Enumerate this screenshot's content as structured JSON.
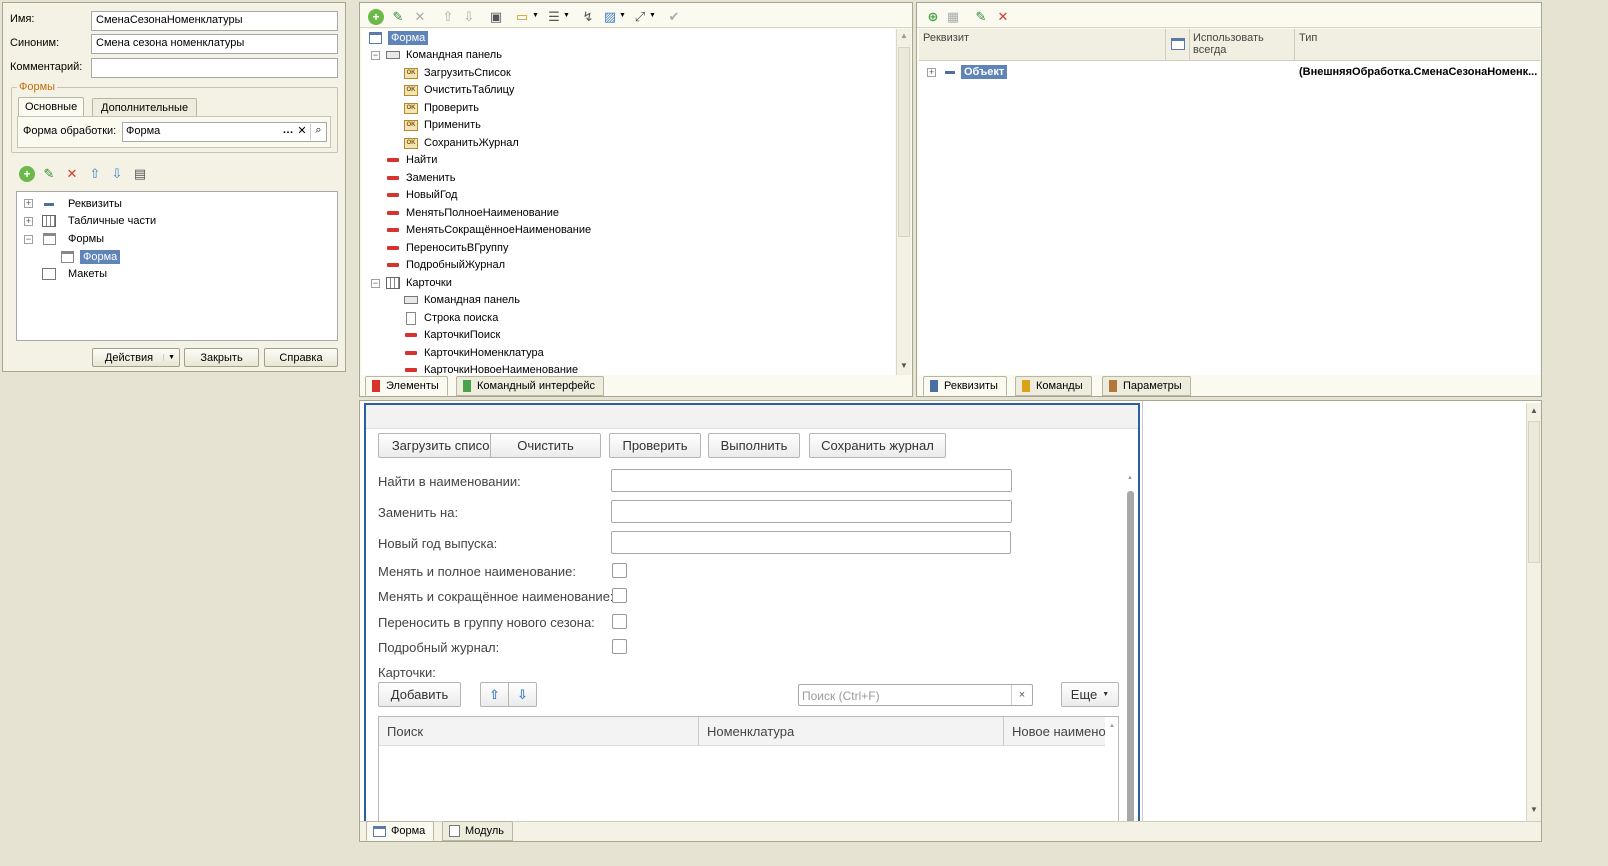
{
  "props": {
    "name_label": "Имя:",
    "name_value": "СменаСезонаНоменклатуры",
    "synonym_label": "Синоним:",
    "synonym_value": "Смена сезона номенклатуры",
    "comment_label": "Комментарий:",
    "comment_value": "",
    "forms_group": "Формы",
    "tab_main": "Основные",
    "tab_extra": "Дополнительные",
    "processing_form_label": "Форма обработки:",
    "processing_form_value": "Форма",
    "tree": [
      {
        "label": "Реквизиты"
      },
      {
        "label": "Табличные части"
      },
      {
        "label": "Формы"
      },
      {
        "label": "Форма"
      },
      {
        "label": "Макеты"
      }
    ],
    "actions_button": "Действия",
    "close_button": "Закрыть",
    "help_button": "Справка"
  },
  "elements": {
    "items": [
      {
        "label": "Форма"
      },
      {
        "label": "Командная панель"
      },
      {
        "label": "ЗагрузитьСписок"
      },
      {
        "label": "ОчиститьТаблицу"
      },
      {
        "label": "Проверить"
      },
      {
        "label": "Применить"
      },
      {
        "label": "СохранитьЖурнал"
      },
      {
        "label": "Найти"
      },
      {
        "label": "Заменить"
      },
      {
        "label": "НовыйГод"
      },
      {
        "label": "МенятьПолноеНаименование"
      },
      {
        "label": "МенятьСокращённоеНаименование"
      },
      {
        "label": "ПереноситьВГруппу"
      },
      {
        "label": "ПодробныйЖурнал"
      },
      {
        "label": "Карточки"
      },
      {
        "label": "Командная панель"
      },
      {
        "label": "Строка поиска"
      },
      {
        "label": "КарточкиПоиск"
      },
      {
        "label": "КарточкиНоменклатура"
      },
      {
        "label": "КарточкиНовоеНаименование"
      }
    ],
    "tab_elements": "Элементы",
    "tab_command_interface": "Командный интерфейс"
  },
  "attributes": {
    "col_attr": "Реквизит",
    "col_always": "Использовать всегда",
    "col_type": "Тип",
    "row_name": "Объект",
    "row_type": "(ВнешняяОбработка.СменаСезонаНоменк...",
    "tab_attrs": "Реквизиты",
    "tab_commands": "Команды",
    "tab_params": "Параметры"
  },
  "preview": {
    "btn_load": "Загрузить список",
    "btn_clear": "Очистить",
    "btn_check": "Проверить",
    "btn_run": "Выполнить",
    "btn_save": "Сохранить журнал",
    "find_label": "Найти в наименовании:",
    "replace_label": "Заменить на:",
    "year_label": "Новый год выпуска:",
    "full_name_label": "Менять и полное наименование:",
    "short_name_label": "Менять и сокращённое наименование:",
    "move_label": "Переносить в группу нового сезона:",
    "log_label": "Подробный журнал:",
    "cards_label": "Карточки:",
    "add_button": "Добавить",
    "search_placeholder": "Поиск (Ctrl+F)",
    "more_button": "Еще",
    "col_search": "Поиск",
    "col_nomenclature": "Номенклатура",
    "col_new_name": "Новое наименование"
  },
  "bottom_tabs": {
    "form": "Форма",
    "module": "Модуль"
  },
  "colors": {
    "selection": "#5f84b8",
    "accent_border": "#2c5f9e",
    "panel_bg": "#fbfaf0",
    "window_bg": "#e6e3d2"
  }
}
